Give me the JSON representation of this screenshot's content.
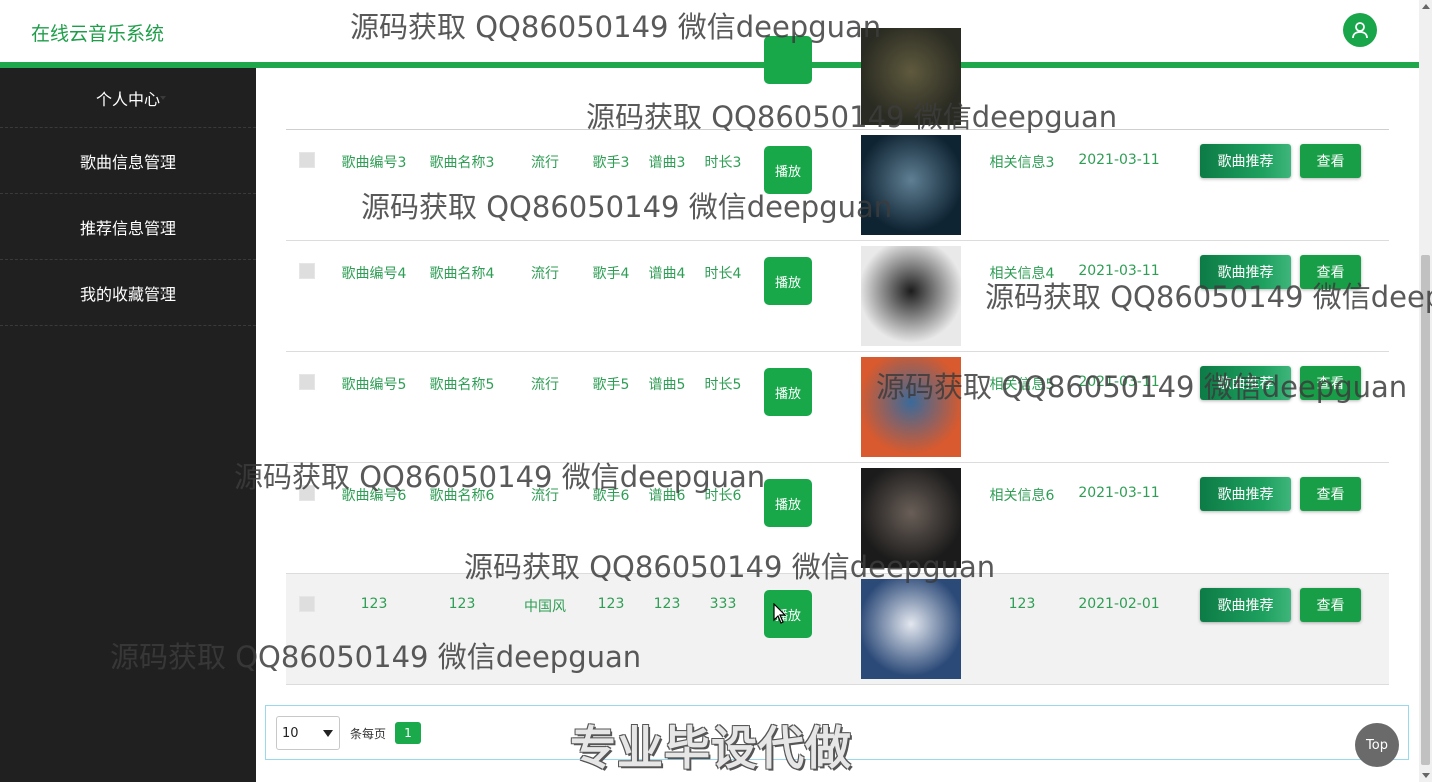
{
  "header": {
    "title": "在线云音乐系统"
  },
  "sidebar": {
    "items": [
      {
        "label": "个人中心"
      },
      {
        "label": "歌曲信息管理"
      },
      {
        "label": "推荐信息管理"
      },
      {
        "label": "我的收藏管理"
      }
    ]
  },
  "table": {
    "rows": [
      {
        "id": "",
        "name": "",
        "genre": "",
        "singer": "",
        "composer": "",
        "duration": "",
        "info": "",
        "date": "",
        "cover_colors": [
          "#2a2b22",
          "#5f5a3e"
        ]
      },
      {
        "id": "歌曲编号3",
        "name": "歌曲名称3",
        "genre": "流行",
        "singer": "歌手3",
        "composer": "谱曲3",
        "duration": "时长3",
        "info": "相关信息3",
        "date": "2021-03-11",
        "cover_colors": [
          "#0f2433",
          "#5f7f93"
        ]
      },
      {
        "id": "歌曲编号4",
        "name": "歌曲名称4",
        "genre": "流行",
        "singer": "歌手4",
        "composer": "谱曲4",
        "duration": "时长4",
        "info": "相关信息4",
        "date": "2021-03-11",
        "cover_colors": [
          "#e9e9e9",
          "#1c1c1c"
        ]
      },
      {
        "id": "歌曲编号5",
        "name": "歌曲名称5",
        "genre": "流行",
        "singer": "歌手5",
        "composer": "谱曲5",
        "duration": "时长5",
        "info": "相关信息5",
        "date": "2021-03-11",
        "cover_colors": [
          "#d85a2e",
          "#3a6a9a"
        ]
      },
      {
        "id": "歌曲编号6",
        "name": "歌曲名称6",
        "genre": "流行",
        "singer": "歌手6",
        "composer": "谱曲6",
        "duration": "时长6",
        "info": "相关信息6",
        "date": "2021-03-11",
        "cover_colors": [
          "#1b1b1b",
          "#6a5f58"
        ]
      },
      {
        "id": "123",
        "name": "123",
        "genre": "中国风",
        "singer": "123",
        "composer": "123",
        "duration": "333",
        "info": "123",
        "date": "2021-02-01",
        "cover_colors": [
          "#2c4a78",
          "#e3e7ef"
        ]
      }
    ],
    "play_label": "播放",
    "recommend_label": "歌曲推荐",
    "view_label": "查看"
  },
  "pagination": {
    "page_size": "10",
    "per_page_label": "条每页",
    "current_page": "1"
  },
  "promo_text": "专业毕设代做",
  "top_button": "Top",
  "watermark_text": "源码获取 QQ86050149 微信deepguan",
  "colors": {
    "accent": "#1ea84b",
    "sidebar_bg": "#202020",
    "text_green": "#2f9e55"
  }
}
